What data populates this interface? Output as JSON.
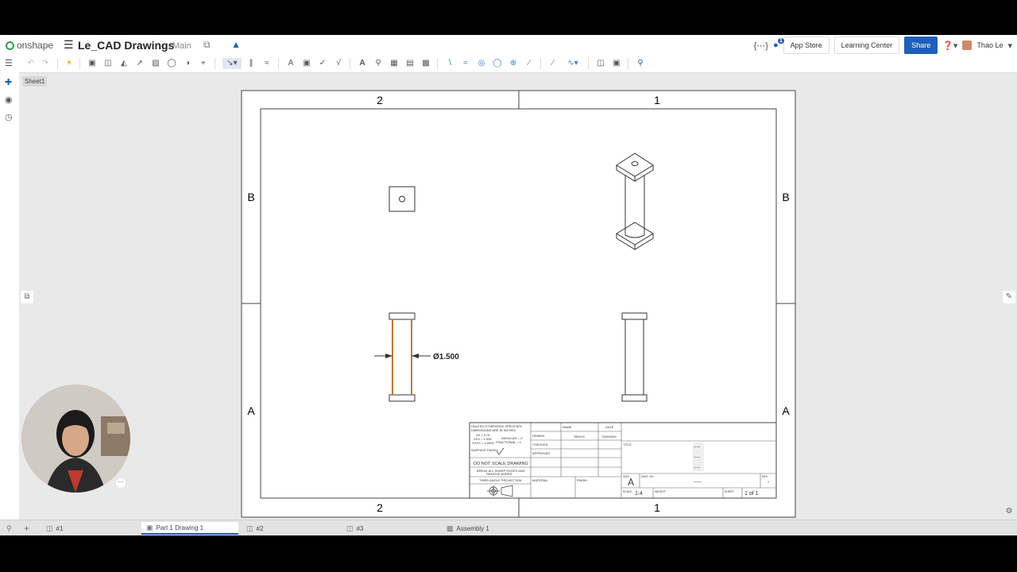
{
  "header": {
    "logo_text": "onshape",
    "doc_title": "Le_CAD Drawings",
    "branch": "Main",
    "app_store": "App Store",
    "learning_center": "Learning Center",
    "share": "Share",
    "user_name": "Thao Le",
    "notification_count": "1"
  },
  "sheet": {
    "name": "Sheet1"
  },
  "drawing": {
    "zone_top_left": "2",
    "zone_top_right": "1",
    "zone_bottom_left": "2",
    "zone_bottom_right": "1",
    "zone_left_upper": "B",
    "zone_left_lower": "A",
    "zone_right_upper": "B",
    "zone_right_lower": "A",
    "dimension": "Ø1.500"
  },
  "title_block": {
    "tolerance_notes": [
      "UNLESS OTHERWISE SPECIFIED:",
      "DIMENSIONS ARE IN INCHES",
      ".XX = ±.01",
      ".XXX = ±.005",
      ".XXXX = ±.0005"
    ],
    "angular": "ANGULAR = ±°",
    "fractional": "FRACTIONAL = ±",
    "surface_finish": "SURFACE FINISH:",
    "do_not_scale": "DO NOT SCALE DRAWING",
    "break_edges": [
      "BREAK ALL SHARP EDGES AND",
      "REMOVE BURRS"
    ],
    "projection": "THIRD ANGLE PROJECTION",
    "col_name": "NAME",
    "col_date": "DATE",
    "drawn": "DRAWN",
    "drawn_name": "TBRXXX",
    "drawn_date": "00/00/0000",
    "checked": "CHECKED",
    "approved": "APPROVED",
    "material": "MATERIAL",
    "finish": "FINISH",
    "title_label": "TITLE",
    "placeholder": "-----",
    "size_label": "SIZE",
    "size_value": "A",
    "dwg_no_label": "DWG. NO.",
    "rev_label": "REV",
    "rev_value": "-",
    "scale_label": "SCALE",
    "scale_value": "1:4",
    "weight_label": "WEIGHT",
    "sheet_label": "SHEET",
    "sheet_value": "1 of 1"
  },
  "tabs": [
    {
      "label": "#1"
    },
    {
      "label": "Part 1 Drawing 1"
    },
    {
      "label": "#2"
    },
    {
      "label": "#3"
    },
    {
      "label": "Assembly 1"
    }
  ],
  "colors": {
    "accent": "#1f5fb6",
    "brand_green": "#2aa24a",
    "highlight": "#c87533"
  }
}
